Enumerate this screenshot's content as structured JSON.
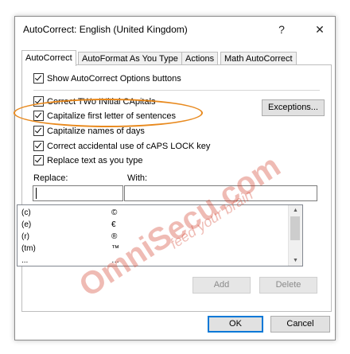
{
  "window": {
    "title": "AutoCorrect: English (United Kingdom)",
    "help_glyph": "?",
    "close_glyph": "✕"
  },
  "tabs": [
    {
      "label": "AutoCorrect",
      "active": true
    },
    {
      "label": "AutoFormat As You Type",
      "active": false
    },
    {
      "label": "Actions",
      "active": false
    },
    {
      "label": "Math AutoCorrect",
      "active": false
    }
  ],
  "options": {
    "show_buttons": {
      "label": "Show AutoCorrect Options buttons",
      "checked": true
    },
    "correct_two_initial": {
      "label": "Correct TWo INitial CApitals",
      "checked": true
    },
    "capitalize_first_letter": {
      "label": "Capitalize first letter of sentences",
      "checked": true
    },
    "capitalize_days": {
      "label": "Capitalize names of days",
      "checked": true
    },
    "caps_lock": {
      "label": "Correct accidental use of cAPS LOCK key",
      "checked": true
    },
    "replace_as_you_type": {
      "label": "Replace text as you type",
      "checked": true
    }
  },
  "exceptions_button": "Exceptions...",
  "replace_label": "Replace:",
  "with_label": "With:",
  "replace_value": "",
  "with_value": "",
  "entries": [
    {
      "replace": "(c)",
      "with": "©"
    },
    {
      "replace": "(e)",
      "with": "€"
    },
    {
      "replace": "(r)",
      "with": "®"
    },
    {
      "replace": "(tm)",
      "with": "™"
    },
    {
      "replace": "...",
      "with": "…"
    }
  ],
  "add_button": "Add",
  "delete_button": "Delete",
  "ok_button": "OK",
  "cancel_button": "Cancel",
  "watermark": {
    "main": "OmniSecu.com",
    "tagline": "feed your brain"
  },
  "colors": {
    "highlight_ellipse": "#e8891d",
    "watermark": "#d23c28",
    "default_button_border": "#0078d7"
  }
}
